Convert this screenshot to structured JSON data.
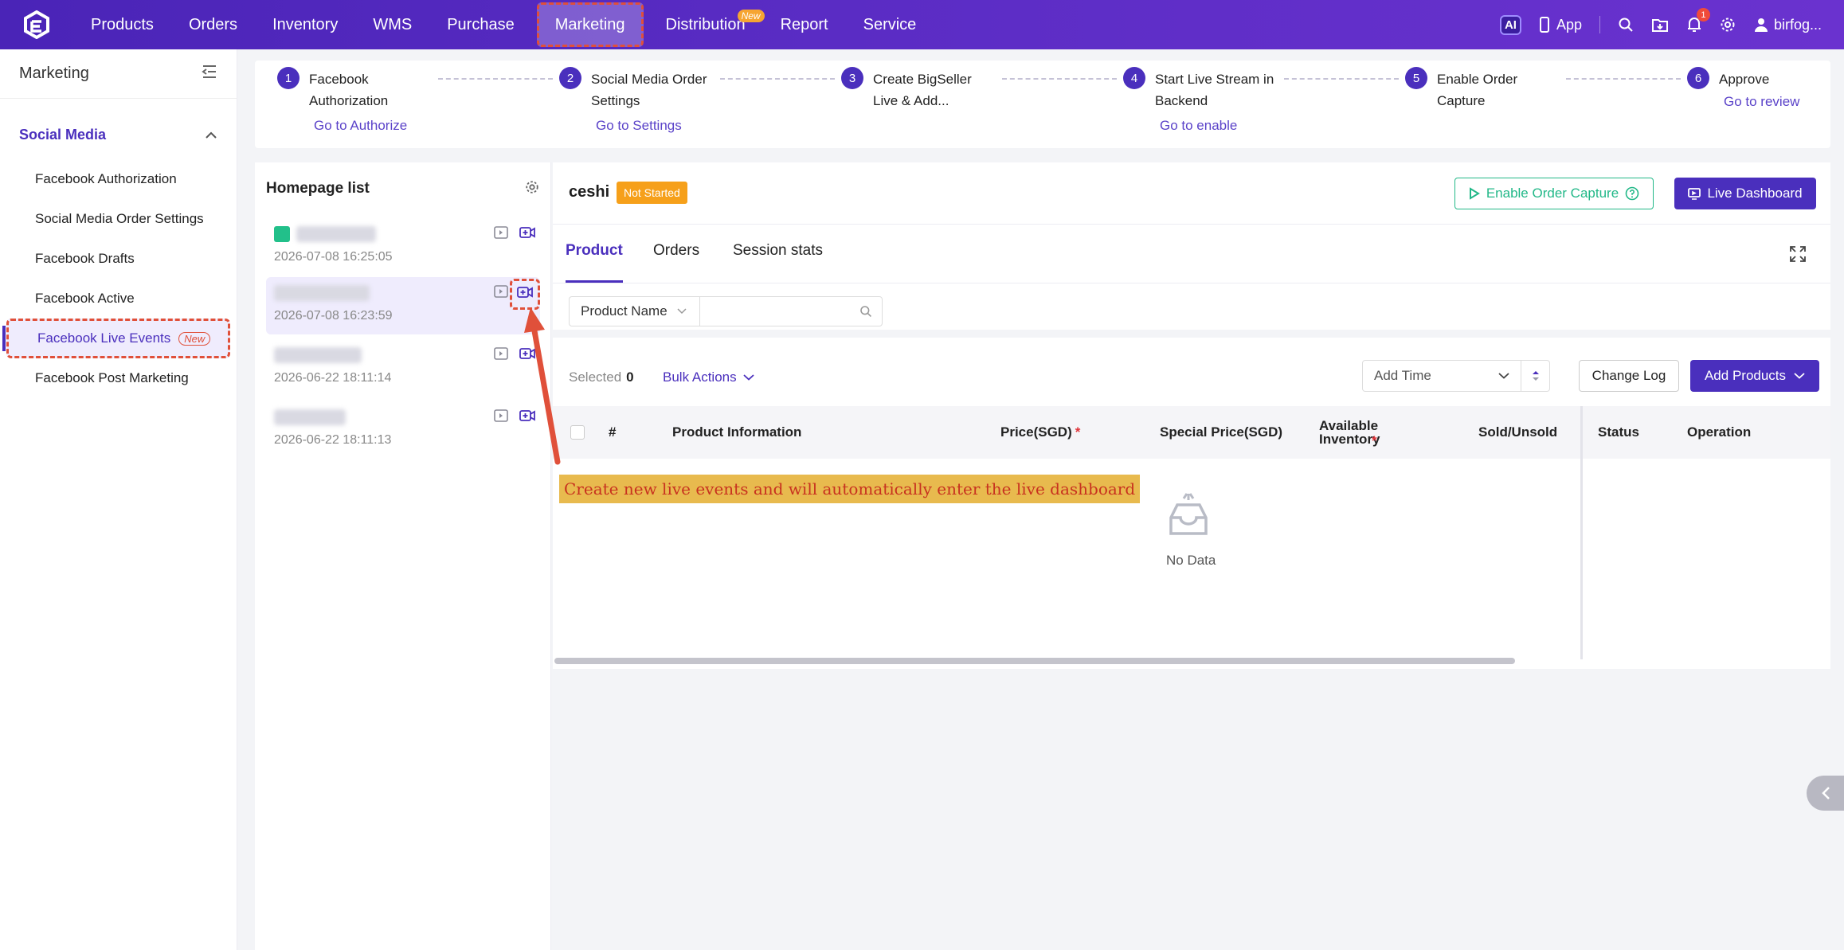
{
  "topnav": {
    "items": [
      "Products",
      "Orders",
      "Inventory",
      "WMS",
      "Purchase",
      "Marketing",
      "Distribution",
      "Report",
      "Service"
    ],
    "active_index": 5,
    "distribution_badge": "New",
    "ai_label": "AI",
    "app_label": "App",
    "notification_count": "1",
    "user_name": "birfog..."
  },
  "sidebar": {
    "title": "Marketing",
    "group_label": "Social Media",
    "items": [
      "Facebook Authorization",
      "Social Media Order Settings",
      "Facebook Drafts",
      "Facebook Active",
      "Facebook Live Events",
      "Facebook Post Marketing"
    ],
    "active_index": 4,
    "new_badge": "New"
  },
  "steps": [
    {
      "num": "1",
      "title": "Facebook Authorization",
      "link": "Go to Authorize"
    },
    {
      "num": "2",
      "title": "Social Media Order Settings",
      "link": "Go to Settings"
    },
    {
      "num": "3",
      "title": "Create BigSeller Live & Add...",
      "link": ""
    },
    {
      "num": "4",
      "title": "Start Live Stream in Backend",
      "link": "Go to enable"
    },
    {
      "num": "5",
      "title": "Enable Order Capture",
      "link": ""
    },
    {
      "num": "6",
      "title": "Approve",
      "link": "Go to review"
    }
  ],
  "homepage": {
    "title": "Homepage list",
    "rows": [
      {
        "time": "2026-07-08 16:25:05"
      },
      {
        "time": "2026-07-08 16:23:59"
      },
      {
        "time": "2026-06-22 18:11:14"
      },
      {
        "time": "2026-06-22 18:11:13"
      }
    ]
  },
  "event": {
    "name": "ceshi",
    "status": "Not Started",
    "enable_capture_label": "Enable Order Capture",
    "live_dashboard_label": "Live Dashboard"
  },
  "tabs": [
    "Product",
    "Orders",
    "Session stats"
  ],
  "filter": {
    "field_label": "Product Name",
    "search_placeholder": ""
  },
  "toolbar": {
    "selected_label": "Selected",
    "selected_count": "0",
    "bulk_actions_label": "Bulk Actions",
    "sort_label": "Add Time",
    "change_log_label": "Change Log",
    "add_products_label": "Add Products"
  },
  "table": {
    "columns": [
      "#",
      "Product Information",
      "Price(SGD)",
      "Special Price(SGD)",
      "Available Inventory",
      "Sold/Unsold",
      "Status",
      "Operation"
    ],
    "required_marker": "*",
    "empty_text": "No Data"
  },
  "annotation": "Create new live events and will automatically enter the live dashboard",
  "colors": {
    "brand": "#4a2fbd",
    "accent_green": "#22b888",
    "status_orange": "#f6a01a",
    "annotation_red": "#e0503a"
  }
}
